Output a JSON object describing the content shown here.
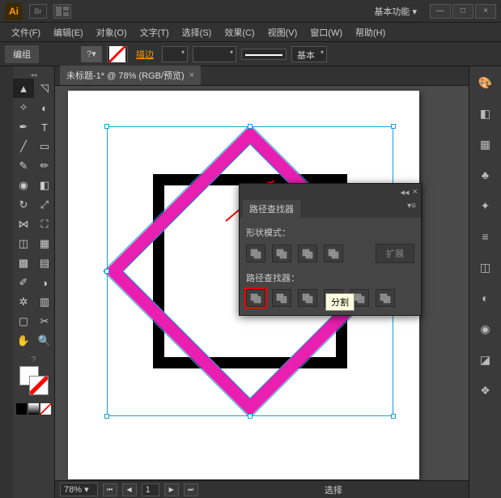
{
  "app": {
    "logo": "Ai",
    "bridge": "Br",
    "workspace": "基本功能"
  },
  "window": {
    "min": "—",
    "max": "□",
    "close": "×"
  },
  "menu": [
    "文件(F)",
    "编辑(E)",
    "对象(O)",
    "文字(T)",
    "选择(S)",
    "效果(C)",
    "视图(V)",
    "窗口(W)",
    "帮助(H)"
  ],
  "control": {
    "mode": "编组",
    "stroke_label": "描边",
    "basic": "基本"
  },
  "tab": {
    "title": "未标题-1* @ 78% (RGB/预览)",
    "close": "×"
  },
  "status": {
    "zoom": "78%",
    "page": "1",
    "tool": "选择"
  },
  "panel": {
    "title": "路径查找器",
    "shape_modes": "形状模式：",
    "expand": "扩展",
    "pathfinders": "路径查找器：",
    "collapse": "◂◂",
    "close": "×",
    "menu": "▾≡"
  },
  "tooltip": "分割",
  "colors": {
    "pink": "#e81fb1",
    "black": "#000000",
    "sel": "#18a0d8"
  }
}
